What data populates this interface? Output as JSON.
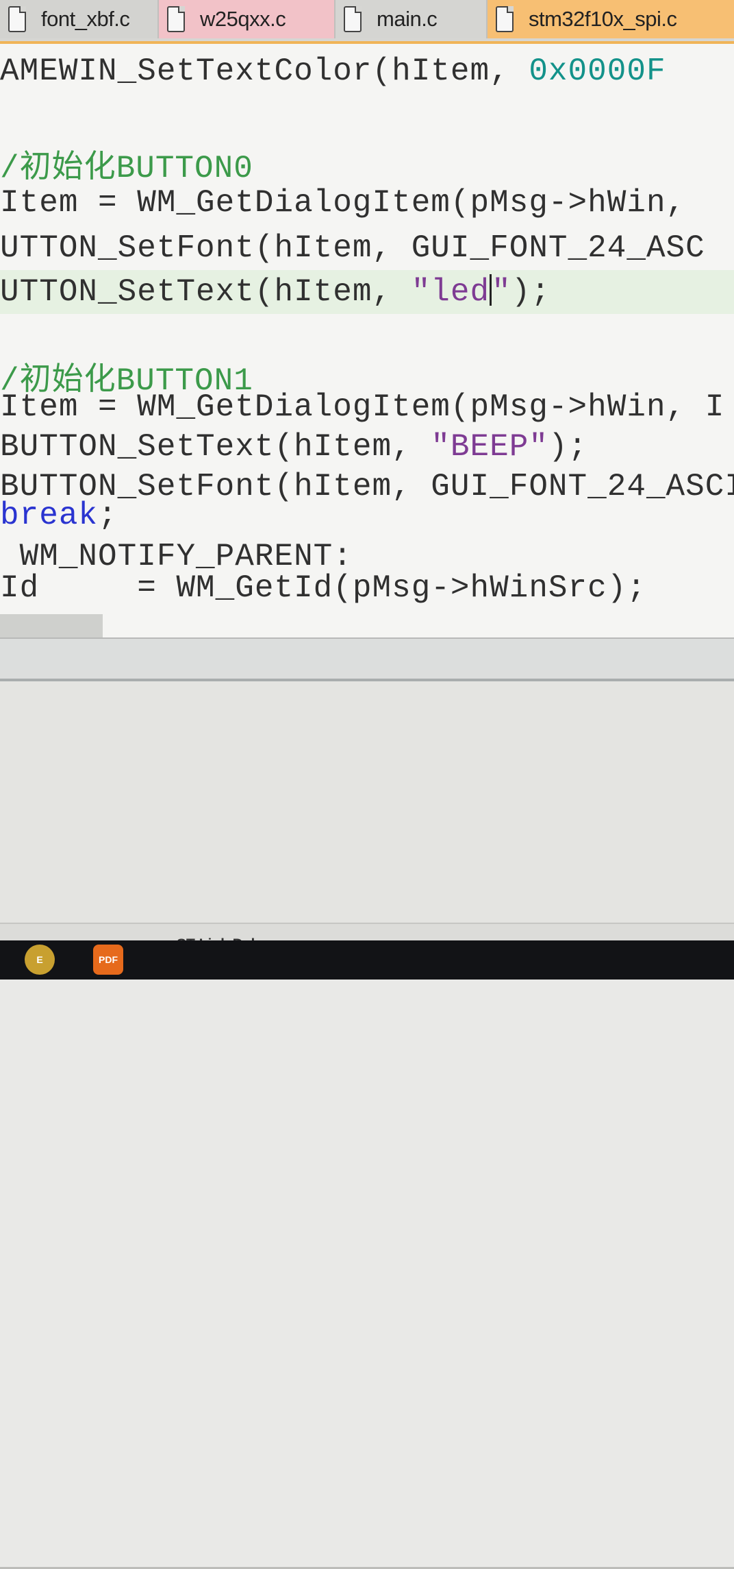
{
  "tabs": [
    {
      "label": "font_xbf.c"
    },
    {
      "label": "w25qxx.c"
    },
    {
      "label": "main.c"
    },
    {
      "label": "stm32f10x_spi.c"
    }
  ],
  "code": {
    "l1_fn": "AMEWIN_SetTextColor(hItem, ",
    "l1_num": "0x0000F",
    "l2_cmt": "/初始化BUTTON0",
    "l3": "Item = WM_GetDialogItem(pMsg->hWin,",
    "l4": "UTTON_SetFont(hItem, GUI_FONT_24_ASC",
    "l5_pre": "UTTON_SetText(hItem, ",
    "l5_str_a": "\"led",
    "l5_str_b": "\"",
    "l5_post": ");",
    "l6_cmt": "/初始化BUTTON1",
    "l7": "Item = WM_GetDialogItem(pMsg->hWin, I",
    "l8_pre": "BUTTON_SetText(hItem, ",
    "l8_str": "\"BEEP\"",
    "l8_post": ");",
    "l9": "BUTTON_SetFont(hItem, GUI_FONT_24_ASCII",
    "l10_kw": "break",
    "l10_post": ";",
    "l11": " WM_NOTIFY_PARENT:",
    "l12": "Id     = WM_GetId(pMsg->hWinSrc);"
  },
  "status": {
    "debugger": "ST-Link Debugger"
  },
  "taskbar": {
    "icon1_glyph": "E",
    "icon2_glyph": "PDF"
  },
  "colors": {
    "active_tab": "#f7bf73",
    "comment": "#3c9a4a",
    "string": "#7e3b93",
    "number": "#13928a",
    "keyword": "#2a34d0"
  }
}
